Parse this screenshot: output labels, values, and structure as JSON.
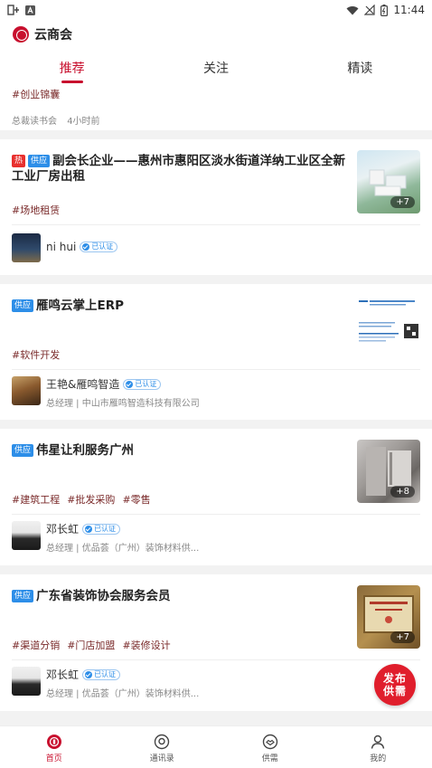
{
  "status_bar": {
    "time": "11:44"
  },
  "app": {
    "title": "云商会"
  },
  "tabs": [
    {
      "label": "推荐",
      "active": true
    },
    {
      "label": "关注",
      "active": false
    },
    {
      "label": "精读",
      "active": false
    }
  ],
  "partial_card": {
    "tag": "#创业锦囊",
    "source": "总裁读书会",
    "time": "4小时前"
  },
  "cards": [
    {
      "badges": [
        "热",
        "供应"
      ],
      "title": "副会长企业——惠州市惠阳区淡水街道洋纳工业区全新工业厂房出租",
      "tags": [
        "#场地租赁"
      ],
      "image_count": "+7",
      "author": "ni hui",
      "verified_label": "已认证",
      "subtitle": ""
    },
    {
      "badges": [
        "供应"
      ],
      "title": "雁鸣云掌上ERP",
      "tags": [
        "#软件开发"
      ],
      "image_count": "",
      "author": "王艳&雁鸣智造",
      "verified_label": "已认证",
      "subtitle": "总经理 | 中山市雁鸣智造科技有限公司"
    },
    {
      "badges": [
        "供应"
      ],
      "title": "伟星让利服务广州",
      "tags": [
        "#建筑工程",
        "#批发采购",
        "#零售"
      ],
      "image_count": "+8",
      "author": "邓长虹",
      "verified_label": "已认证",
      "subtitle": "总经理 | 优品荟（广州）装饰材料供..."
    },
    {
      "badges": [
        "供应"
      ],
      "title": "广东省装饰协会服务会员",
      "tags": [
        "#渠道分销",
        "#门店加盟",
        "#装修设计"
      ],
      "image_count": "+7",
      "author": "邓长虹",
      "verified_label": "已认证",
      "subtitle": "总经理 | 优品荟（广州）装饰材料供..."
    }
  ],
  "fab": {
    "line1": "发布",
    "line2": "供需"
  },
  "bottom_nav": [
    {
      "label": "首页",
      "icon": "home-icon",
      "active": true
    },
    {
      "label": "通讯录",
      "icon": "contacts-icon",
      "active": false
    },
    {
      "label": "供需",
      "icon": "handshake-icon",
      "active": false
    },
    {
      "label": "我的",
      "icon": "profile-icon",
      "active": false
    }
  ],
  "colors": {
    "accent": "#c8102e",
    "supply_badge": "#2d8ee8",
    "hot_badge": "#e8302e",
    "tag_text": "#7a2a2a"
  }
}
